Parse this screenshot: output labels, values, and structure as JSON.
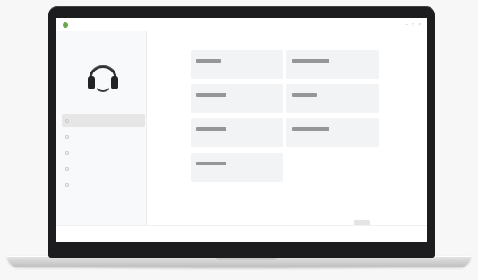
{
  "app": {
    "title": "",
    "brand_icon": "brand-dot-icon",
    "top_icons": [
      "minimize-icon",
      "maximize-icon",
      "close-icon"
    ]
  },
  "sidebar": {
    "device_image": "headset-icon",
    "items": [
      {
        "label": "",
        "icon": "radio-dot-icon",
        "active": true
      },
      {
        "label": "",
        "icon": "radio-dot-icon",
        "active": false
      },
      {
        "label": "",
        "icon": "radio-dot-icon",
        "active": false
      },
      {
        "label": "",
        "icon": "radio-dot-icon",
        "active": false
      },
      {
        "label": "",
        "icon": "radio-dot-icon",
        "active": false
      }
    ]
  },
  "main": {
    "fields": [
      {
        "label": "",
        "value": ""
      },
      {
        "label": "",
        "value": ""
      },
      {
        "label": "",
        "value": ""
      },
      {
        "label": "",
        "value": ""
      },
      {
        "label": "",
        "value": ""
      },
      {
        "label": "",
        "value": ""
      },
      {
        "label": "",
        "value": ""
      }
    ],
    "save_label": ""
  },
  "colors": {
    "bezel": "#1d1d1f",
    "screen": "#ffffff",
    "sidebar": "#f8f9fa",
    "card": "#f1f3f4",
    "accent": "#6aa84f"
  }
}
